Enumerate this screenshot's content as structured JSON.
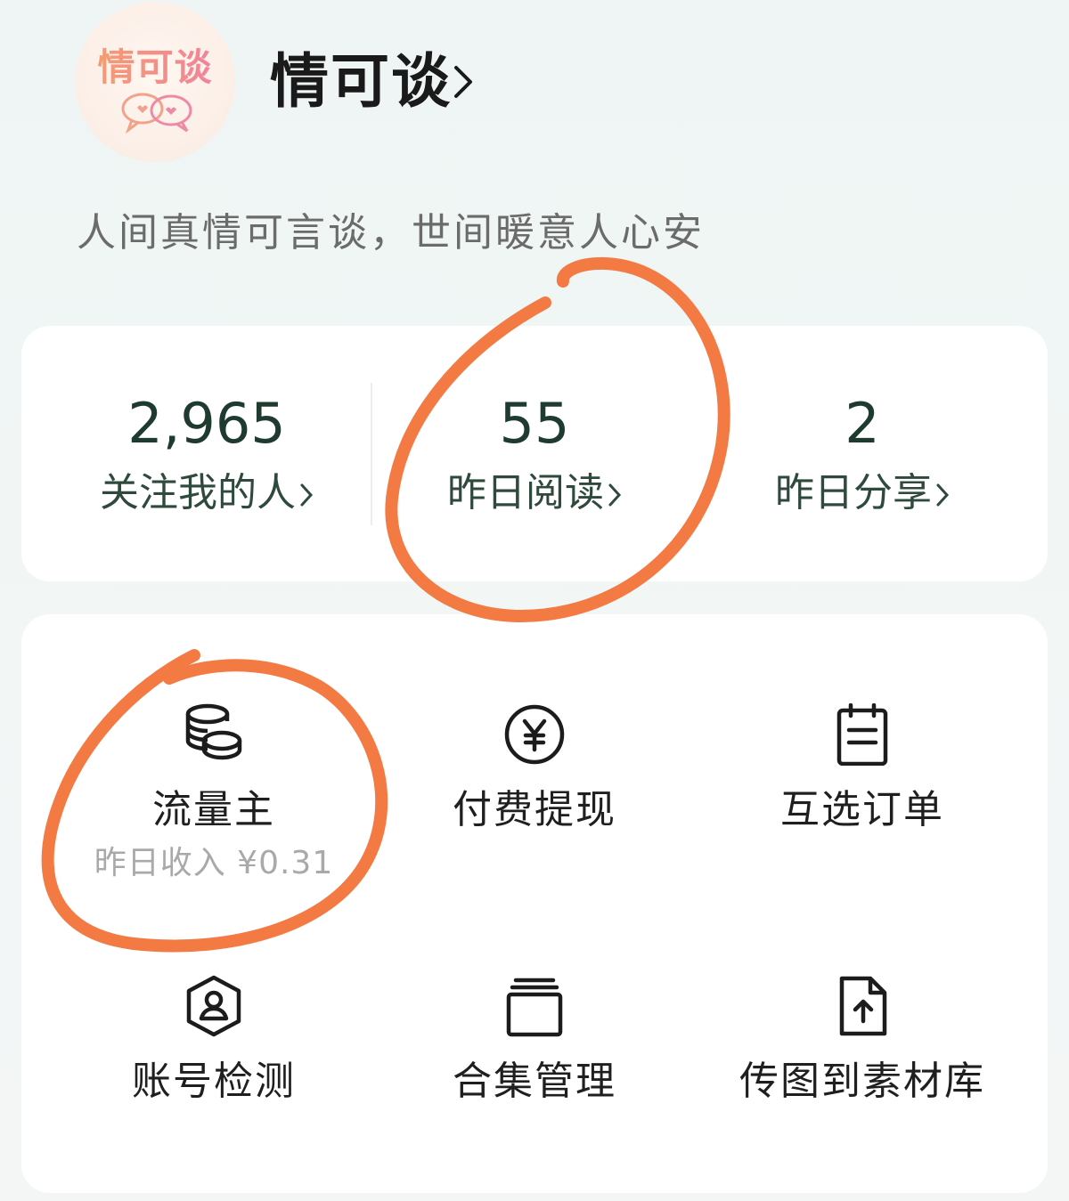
{
  "profile": {
    "avatar_text": "情可谈",
    "name": "情可谈",
    "bio": "人间真情可言谈，世间暖意人心安"
  },
  "stats": [
    {
      "value": "2,965",
      "label": "关注我的人"
    },
    {
      "value": "55",
      "label": "昨日阅读"
    },
    {
      "value": "2",
      "label": "昨日分享"
    }
  ],
  "tools": [
    {
      "label": "流量主",
      "sub": "昨日收入 ¥0.31",
      "icon": "coins-icon"
    },
    {
      "label": "付费提现",
      "sub": "",
      "icon": "yen-circle-icon"
    },
    {
      "label": "互选订单",
      "sub": "",
      "icon": "notepad-icon"
    },
    {
      "label": "账号检测",
      "sub": "",
      "icon": "user-shield-icon"
    },
    {
      "label": "合集管理",
      "sub": "",
      "icon": "collection-icon"
    },
    {
      "label": "传图到素材库",
      "sub": "",
      "icon": "file-upload-icon"
    }
  ],
  "colors": {
    "annotation": "#f47a44",
    "stat_text": "#1f3a2e"
  }
}
